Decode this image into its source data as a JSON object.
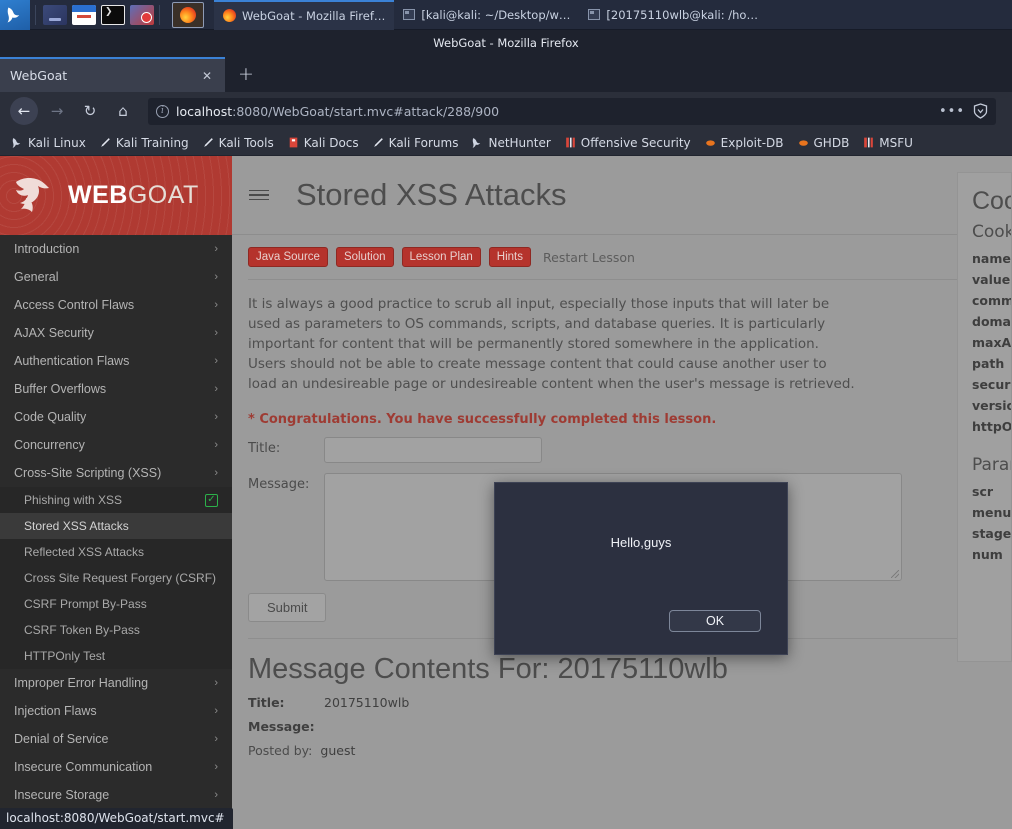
{
  "taskbar": {
    "launcher_icon": "kali-dragon-icon",
    "quick_icons": [
      "files-manager-icon",
      "file-browser-icon",
      "terminal-icon",
      "screen-recorder-icon"
    ],
    "active_app_icon": "firefox-icon",
    "windows": [
      {
        "label": "WebGoat - Mozilla Firef…",
        "icon": "firefox-icon",
        "active": true
      },
      {
        "label": "[kali@kali: ~/Desktop/w…",
        "icon": "terminal-icon",
        "active": false
      },
      {
        "label": "[20175110wlb@kali: /ho…",
        "icon": "terminal-icon",
        "active": false
      }
    ]
  },
  "window": {
    "title": "WebGoat - Mozilla Firefox"
  },
  "browser": {
    "tab": {
      "title": "WebGoat",
      "close_label": "✕"
    },
    "new_tab_label": "+",
    "nav": {
      "back": "←",
      "forward": "→",
      "reload": "↻",
      "home": "⌂"
    },
    "url": {
      "host": "localhost",
      "rest": ":8080/WebGoat/start.mvc#attack/288/900",
      "full": "localhost:8080/WebGoat/start.mvc#attack/288/900"
    },
    "urlbar_menu_label": "•••",
    "bookmarks": [
      {
        "label": "Kali Linux",
        "icon": "kali-dragon-icon"
      },
      {
        "label": "Kali Training",
        "icon": "pen-icon"
      },
      {
        "label": "Kali Tools",
        "icon": "pen-icon"
      },
      {
        "label": "Kali Docs",
        "icon": "book-icon"
      },
      {
        "label": "Kali Forums",
        "icon": "pen-icon"
      },
      {
        "label": "NetHunter",
        "icon": "kali-dragon-icon"
      },
      {
        "label": "Offensive Security",
        "icon": "offsec-icon"
      },
      {
        "label": "Exploit-DB",
        "icon": "flame-icon"
      },
      {
        "label": "GHDB",
        "icon": "flame-icon"
      },
      {
        "label": "MSFU",
        "icon": "offsec-icon"
      }
    ]
  },
  "webgoat": {
    "brand": {
      "web": "WEB",
      "goat": "GOAT",
      "logo_icon": "goat-head-icon"
    },
    "sidebar": [
      {
        "label": "Introduction",
        "caret": "›",
        "type": "group"
      },
      {
        "label": "General",
        "caret": "›",
        "type": "group"
      },
      {
        "label": "Access Control Flaws",
        "caret": "›",
        "type": "group"
      },
      {
        "label": "AJAX Security",
        "caret": "›",
        "type": "group"
      },
      {
        "label": "Authentication Flaws",
        "caret": "›",
        "type": "group"
      },
      {
        "label": "Buffer Overflows",
        "caret": "›",
        "type": "group"
      },
      {
        "label": "Code Quality",
        "caret": "›",
        "type": "group"
      },
      {
        "label": "Concurrency",
        "caret": "›",
        "type": "group"
      },
      {
        "label": "Cross-Site Scripting (XSS)",
        "caret": "›",
        "type": "group",
        "expanded": true
      },
      {
        "label": "Phishing with XSS",
        "type": "lesson",
        "completed": true,
        "check": "✓"
      },
      {
        "label": "Stored XSS Attacks",
        "type": "lesson",
        "selected": true
      },
      {
        "label": "Reflected XSS Attacks",
        "type": "lesson"
      },
      {
        "label": "Cross Site Request Forgery (CSRF)",
        "type": "lesson"
      },
      {
        "label": "CSRF Prompt By-Pass",
        "type": "lesson"
      },
      {
        "label": "CSRF Token By-Pass",
        "type": "lesson"
      },
      {
        "label": "HTTPOnly Test",
        "type": "lesson"
      },
      {
        "label": "Improper Error Handling",
        "caret": "›",
        "type": "group"
      },
      {
        "label": "Injection Flaws",
        "caret": "›",
        "type": "group"
      },
      {
        "label": "Denial of Service",
        "caret": "›",
        "type": "group"
      },
      {
        "label": "Insecure Communication",
        "caret": "›",
        "type": "group"
      },
      {
        "label": "Insecure Storage",
        "caret": "›",
        "type": "group"
      }
    ],
    "lesson": {
      "title": "Stored XSS Attacks",
      "menu_icon": "hamburger-icon",
      "buttons": [
        "Java Source",
        "Solution",
        "Lesson Plan",
        "Hints"
      ],
      "restart_label": "Restart Lesson",
      "paragraph": "It is always a good practice to scrub all input, especially those inputs that will later be used as parameters to OS commands, scripts, and database queries. It is particularly important for content that will be permanently stored somewhere in the application. Users should not be able to create message content that could cause another user to load an undesireable page or undesireable content when the user's message is retrieved.",
      "congrats": "* Congratulations. You have successfully completed this lesson."
    },
    "form": {
      "title_label": "Title:",
      "title_value": "",
      "message_label": "Message:",
      "message_value": "",
      "submit_label": "Submit"
    },
    "message_contents": {
      "heading": "Message Contents For: 20175110wlb",
      "title_key": "Title:",
      "title_value": "20175110wlb",
      "message_key": "Message:",
      "message_value": "",
      "posted_key": "Posted by:",
      "posted_value": "guest"
    },
    "right_panel": {
      "heading": "Cookies and Parameters",
      "cookies_heading": "Cookies",
      "cookie_rows": [
        "name",
        "value",
        "comment",
        "domain",
        "maxAge",
        "path",
        "secure",
        "version",
        "httpOnly"
      ],
      "params_heading": "Parameters",
      "param_rows": [
        "scr",
        "menu",
        "stage",
        "num"
      ]
    }
  },
  "dialog": {
    "message": "Hello,guys",
    "ok_label": "OK"
  },
  "status_bar": {
    "text": "localhost:8080/WebGoat/start.mvc#"
  },
  "colors": {
    "webgoat_red": "#b03a32",
    "lesson_btn_red": "#b5332c",
    "accent_blue": "#3b82d6",
    "success_green": "#2cb14a",
    "congrats_red": "#9e3b33"
  }
}
